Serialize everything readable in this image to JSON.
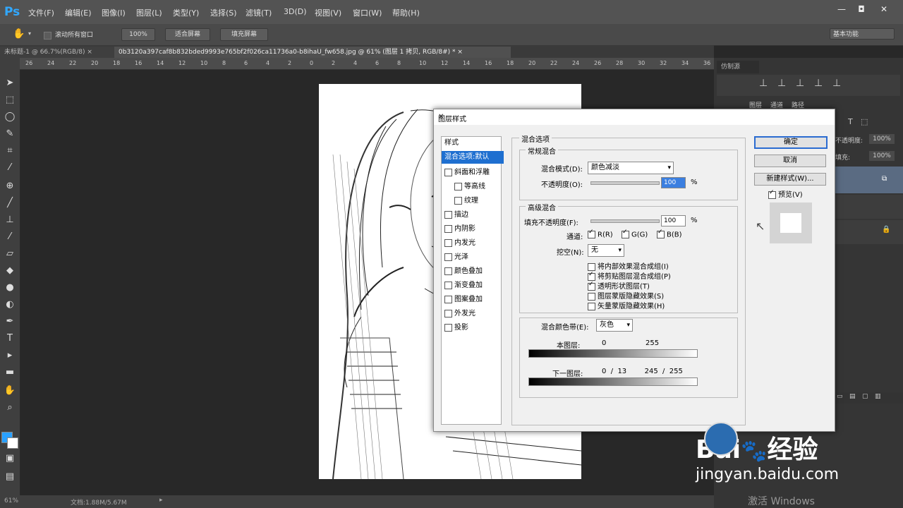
{
  "app": {
    "logo": "Ps"
  },
  "menu": [
    "文件(F)",
    "编辑(E)",
    "图像(I)",
    "图层(L)",
    "类型(Y)",
    "选择(S)",
    "滤镜(T)",
    "3D(D)",
    "视图(V)",
    "窗口(W)",
    "帮助(H)"
  ],
  "options": {
    "scroll_all": "滚动所有窗口",
    "zoom_100": "100%",
    "fit_screen": "适合屏幕",
    "fill_screen": "填充屏幕",
    "workspace": "基本功能"
  },
  "tabs": [
    {
      "label": "未标题-1 @ 66.7%(RGB/8)",
      "close": "×"
    },
    {
      "label": "0b3120a397caf8b832bded9993e765bf2f026ca11736a0-b8ihaU_fw658.jpg @ 61% (图层 1 拷贝, RGB/8#) *",
      "close": "×"
    }
  ],
  "ruler_ticks": [
    "26",
    "24",
    "22",
    "20",
    "18",
    "16",
    "14",
    "12",
    "10",
    "8",
    "6",
    "4",
    "2",
    "0",
    "2",
    "4",
    "6",
    "8",
    "10",
    "12",
    "14",
    "16",
    "18",
    "20",
    "22",
    "24",
    "26",
    "28",
    "30",
    "32",
    "34",
    "36"
  ],
  "status": {
    "zoom": "61%",
    "doc": "文档:1.88M/5.67M"
  },
  "right_panel": {
    "title": "仿制源",
    "tabs": [
      "图层",
      "通道",
      "路径"
    ],
    "opacity_label": "不透明度:",
    "opacity_value": "100%",
    "fill_label": "填充:",
    "fill_value": "100%"
  },
  "dialog": {
    "title": "图层样式",
    "close": "✕",
    "sidebar_header": "样式",
    "sidebar_selected": "混合选项:默认",
    "sidebar_items": [
      "斜面和浮雕",
      "等高线",
      "纹理",
      "描边",
      "内阴影",
      "内发光",
      "光泽",
      "颜色叠加",
      "渐变叠加",
      "图案叠加",
      "外发光",
      "投影"
    ],
    "blend_options_title": "混合选项",
    "general_title": "常规混合",
    "blend_mode_label": "混合模式(D):",
    "blend_mode_value": "颜色减淡",
    "opacity_label": "不透明度(O):",
    "opacity_value": "100",
    "percent": "%",
    "advanced_title": "高级混合",
    "fill_opacity_label": "填充不透明度(F):",
    "fill_opacity_value": "100",
    "channels_label": "通道:",
    "channel_r": "R(R)",
    "channel_g": "G(G)",
    "channel_b": "B(B)",
    "knockout_label": "挖空(N):",
    "knockout_value": "无",
    "opt1": "将内部效果混合成组(I)",
    "opt2": "将剪贴图层混合成组(P)",
    "opt3": "透明形状图层(T)",
    "opt4": "图层蒙版隐藏效果(S)",
    "opt5": "矢量蒙版隐藏效果(H)",
    "blend_if_label": "混合颜色带(E):",
    "blend_if_value": "灰色",
    "this_layer_label": "本图层:",
    "this_layer_low": "0",
    "this_layer_high": "255",
    "underlying_label": "下一图层:",
    "underlying_values": "0  /  13        245  /  255",
    "ok": "确定",
    "cancel": "取消",
    "new_style": "新建样式(W)...",
    "preview": "预览(V)"
  },
  "watermark": {
    "brand": "Bai",
    "brand2": "经验",
    "url": "jingyan.baidu.com",
    "win": "激活 Windows"
  }
}
